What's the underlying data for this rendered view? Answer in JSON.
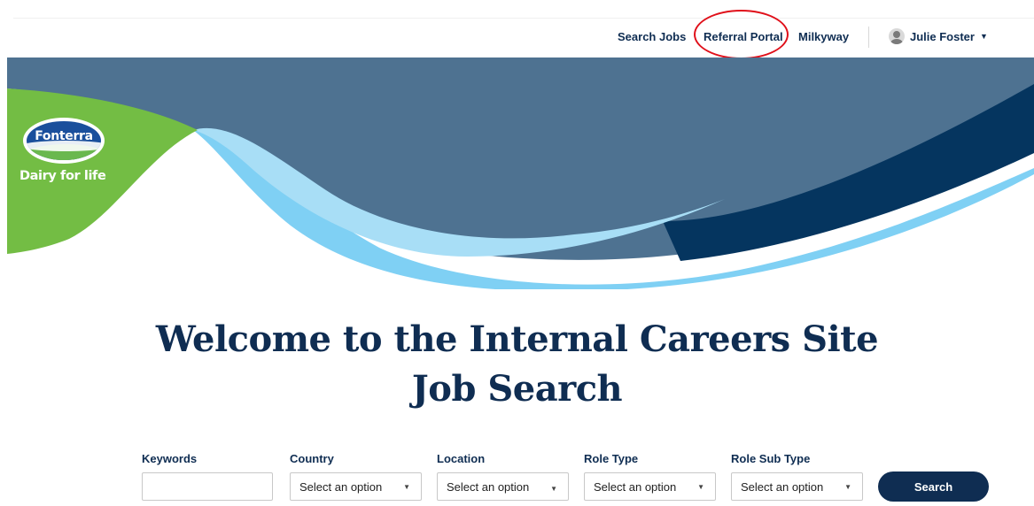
{
  "nav": {
    "links": [
      {
        "label": "Search Jobs"
      },
      {
        "label": "Referral Portal"
      },
      {
        "label": "Milkyway"
      }
    ],
    "user": {
      "name": "Julie Foster",
      "avatar_icon": "user-avatar-icon",
      "caret_icon": "caret-down-icon"
    },
    "highlighted_link": "Referral Portal",
    "highlight_color": "#e0101a"
  },
  "brand": {
    "name": "Fonterra",
    "tagline": "Dairy for life",
    "colors": {
      "navy": "#0f2d52",
      "slate_blue": "#4e7291",
      "light_blue": "#7fd0f4",
      "green": "#73bd44"
    }
  },
  "heading": {
    "line1": "Welcome to the Internal Careers Site",
    "line2": "Job Search"
  },
  "search_form": {
    "keywords": {
      "label": "Keywords",
      "value": "",
      "placeholder": ""
    },
    "country": {
      "label": "Country",
      "selected": "Select an option"
    },
    "location": {
      "label": "Location",
      "selected": "Select an option"
    },
    "role_type": {
      "label": "Role Type",
      "selected": "Select an option"
    },
    "role_sub_type": {
      "label": "Role Sub Type",
      "selected": "Select an option"
    },
    "submit_label": "Search"
  }
}
